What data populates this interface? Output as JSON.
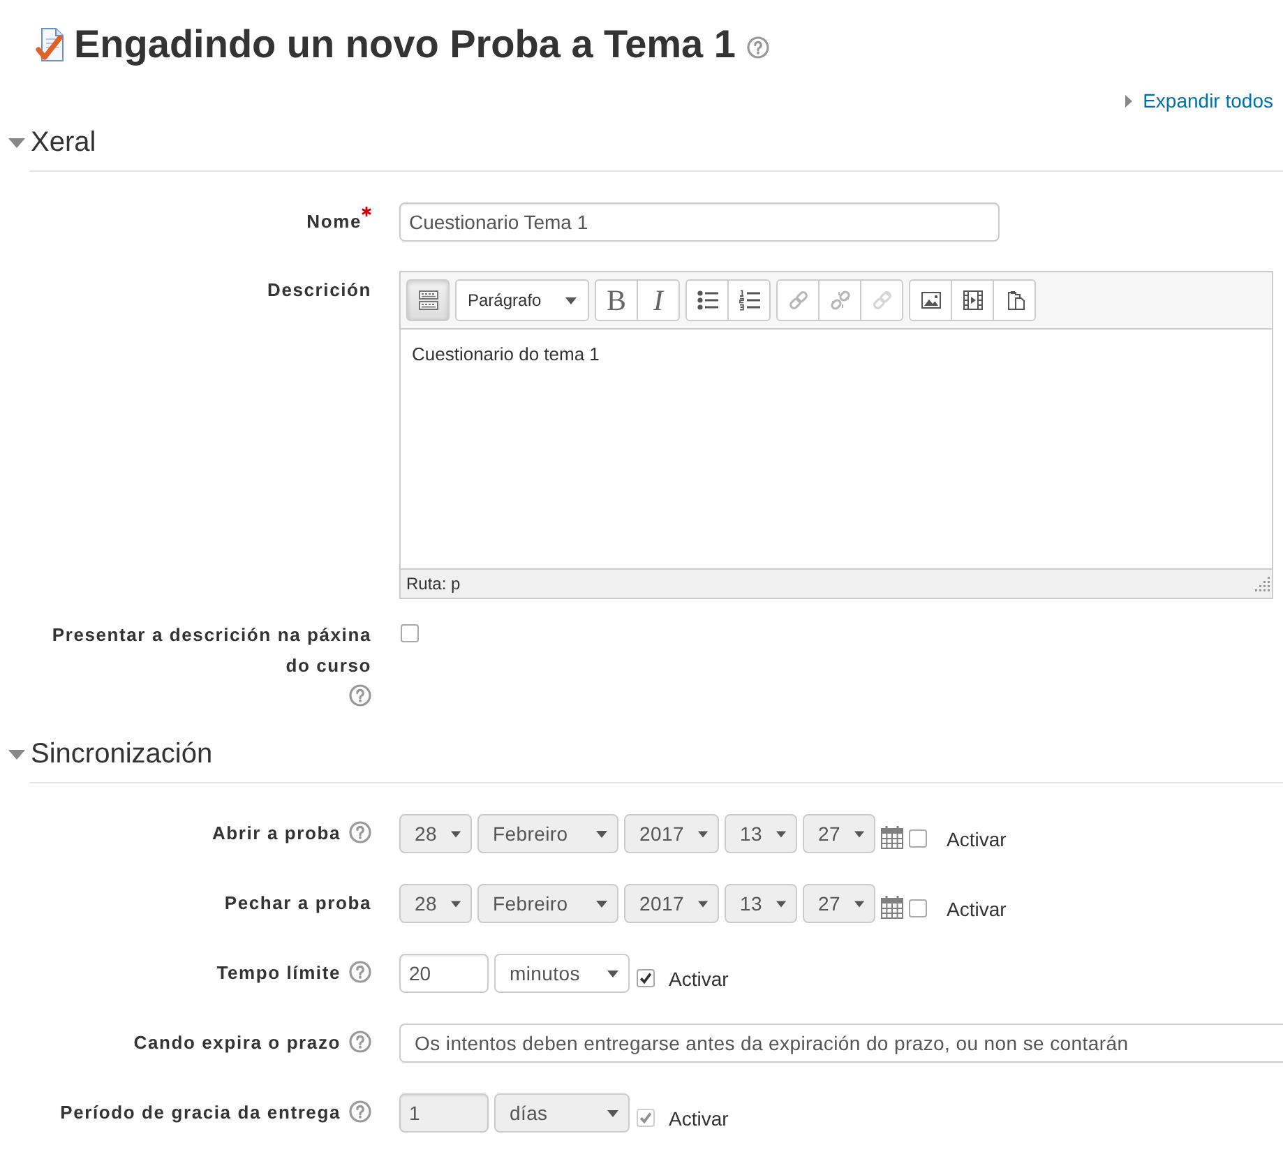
{
  "heading": {
    "title": "Engadindo un novo Proba a Tema 1",
    "help": true
  },
  "expand_all": {
    "label": "Expandir todos"
  },
  "sections": [
    {
      "title": "Xeral",
      "expanded": true,
      "fields": [
        {
          "kind": "text",
          "label": "Nome",
          "required": true,
          "help": false,
          "value": "Cuestionario Tema 1"
        },
        {
          "kind": "editor",
          "label": "Descrición",
          "required": false,
          "help": false,
          "toolbar": [
            {
              "buttons": [
                {
                  "kind": "toggle",
                  "on": true,
                  "disabled": false
                }
              ]
            },
            {
              "buttons": [
                {
                  "kind": "format",
                  "label": "Parágrafo",
                  "on": false,
                  "disabled": false
                }
              ]
            },
            {
              "buttons": [
                {
                  "kind": "bold",
                  "label": "B",
                  "on": false,
                  "disabled": false
                },
                {
                  "kind": "italic",
                  "label": "I",
                  "on": false,
                  "disabled": false
                }
              ]
            },
            {
              "buttons": [
                {
                  "kind": "bullets",
                  "on": false,
                  "disabled": false
                },
                {
                  "kind": "numbered",
                  "on": false,
                  "disabled": false
                }
              ]
            },
            {
              "buttons": [
                {
                  "kind": "link",
                  "on": false,
                  "disabled": true
                },
                {
                  "kind": "unlink",
                  "on": false,
                  "disabled": true
                },
                {
                  "kind": "nolink",
                  "on": false,
                  "disabled": true
                }
              ]
            },
            {
              "buttons": [
                {
                  "kind": "image",
                  "on": false,
                  "disabled": false
                },
                {
                  "kind": "media",
                  "on": false,
                  "disabled": false
                },
                {
                  "kind": "paste",
                  "on": false,
                  "disabled": false
                }
              ]
            }
          ],
          "content": "Cuestionario do tema 1",
          "path": "Ruta: p"
        },
        {
          "kind": "checkbox",
          "label": "Presentar a descrición na páxina do curso",
          "required": false,
          "help": true,
          "checked": false
        }
      ]
    },
    {
      "title": "Sincronización",
      "expanded": true,
      "fields": [
        {
          "kind": "datetime",
          "label": "Abrir a proba",
          "required": false,
          "help": true,
          "parts": [
            "28",
            "Febreiro",
            "2017",
            "13",
            "27"
          ],
          "enable": {
            "label": "Activar",
            "checked": false
          }
        },
        {
          "kind": "datetime",
          "label": "Pechar a proba",
          "required": false,
          "help": false,
          "parts": [
            "28",
            "Febreiro",
            "2017",
            "13",
            "27"
          ],
          "enable": {
            "label": "Activar",
            "checked": false
          }
        },
        {
          "kind": "duration",
          "label": "Tempo límite",
          "required": false,
          "help": true,
          "value": "20",
          "unit": "minutos",
          "disabled": false,
          "enable": {
            "label": "Activar",
            "checked": true
          }
        },
        {
          "kind": "select",
          "label": "Cando expira o prazo",
          "required": false,
          "help": true,
          "value": "Os intentos deben entregarse antes da expiración do prazo, ou non se contarán"
        },
        {
          "kind": "duration",
          "label": "Período de gracia da entrega",
          "required": false,
          "help": true,
          "value": "1",
          "unit": "días",
          "disabled": true,
          "enable": {
            "label": "Activar",
            "checked": true
          }
        }
      ]
    }
  ]
}
